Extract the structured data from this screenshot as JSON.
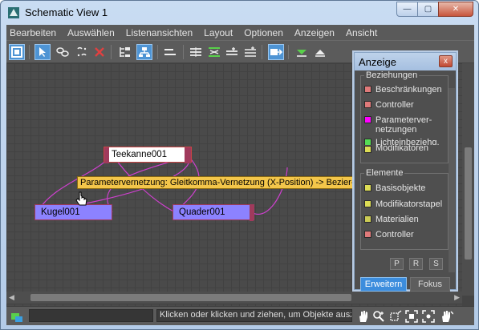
{
  "window": {
    "title": "Schematic View 1",
    "buttons": {
      "minimize": "—",
      "maximize": "▢",
      "close": "✕"
    }
  },
  "menubar": [
    "Bearbeiten",
    "Auswählen",
    "Listenansichten",
    "Layout",
    "Optionen",
    "Anzeigen",
    "Ansicht"
  ],
  "toolbar": {
    "icons": [
      "display-floater-icon",
      "select-icon",
      "connect-icon",
      "unlink-selected-icon",
      "delete-icon",
      "hierarchy-mode-icon",
      "references-mode-icon",
      "move-children-icon",
      "align-left-icon",
      "align-center-icon",
      "insert-above-icon",
      "insert-below-icon",
      "show-all-icon",
      "expand-icon",
      "collapse-icon"
    ]
  },
  "canvas": {
    "nodes": {
      "teapot": "Teekanne001",
      "sphere": "Kugel001",
      "box": "Quader001"
    },
    "tooltip": "Parametervernetzung: Gleitkomma-Vernetzung (X-Position) -> Bezier-Gleiten (Radius) (Radius)"
  },
  "panel": {
    "title": "Anzeige",
    "close": "x",
    "group_relations": {
      "label": "Beziehungen",
      "items": [
        {
          "label": "Beschränkungen",
          "color": "#e07a7a"
        },
        {
          "label": "Controller",
          "color": "#e07a7a"
        },
        {
          "label": "Parameterver-netzungen",
          "color": "#ff00ff"
        },
        {
          "label": "Lichteinbeziehg.",
          "color": "#55dd55"
        },
        {
          "label": "Modifikatoren",
          "color": "#dddd55"
        }
      ]
    },
    "group_entities": {
      "label": "Elemente",
      "items": [
        {
          "label": "Basisobjekte",
          "color": "#dddd55"
        },
        {
          "label": "Modifikatorstapel",
          "color": "#dddd55"
        },
        {
          "label": "Materialien",
          "color": "#cccc55"
        },
        {
          "label": "Controller",
          "color": "#e07a7a"
        }
      ]
    },
    "small_buttons": [
      "P",
      "R",
      "S"
    ],
    "expand_button": "Erweitern",
    "focus_button": "Fokus"
  },
  "statusbar": {
    "message": "Klicken oder klicken und ziehen, um Objekte auszuwählen"
  }
}
